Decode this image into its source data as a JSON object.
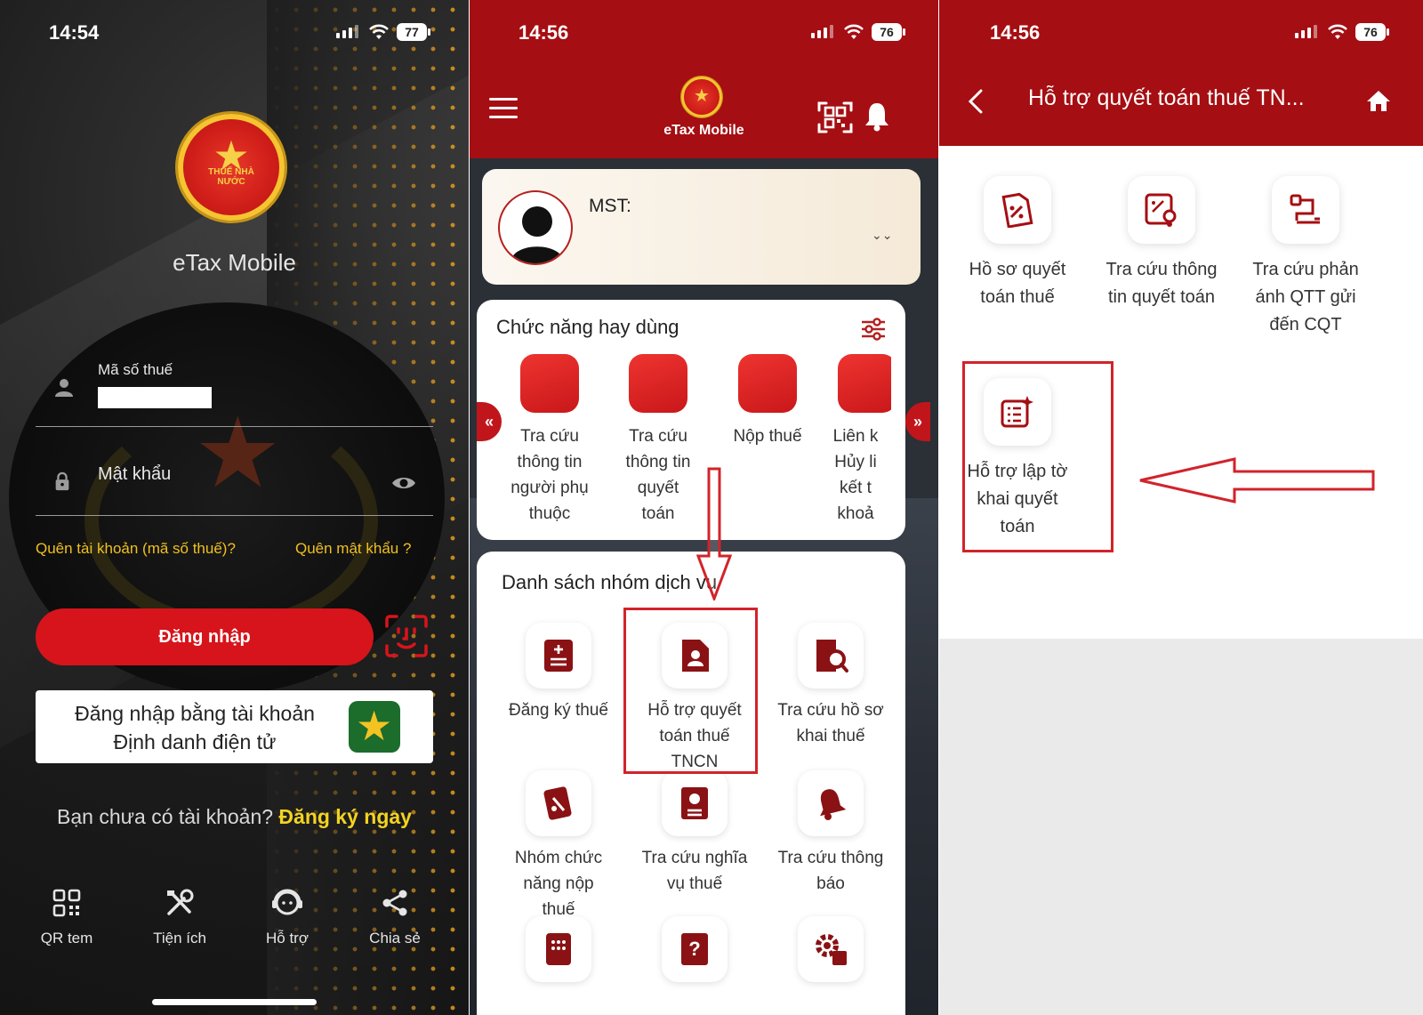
{
  "panel1": {
    "status": {
      "time": "14:54",
      "battery": "77"
    },
    "emblem_text": "THUẾ NHÀ NƯỚC",
    "app_title": "eTax Mobile",
    "tax_code_label": "Mã số thuế",
    "password_placeholder": "Mật khẩu",
    "forgot_account": "Quên tài khoản (mã số thuế)?",
    "forgot_password": "Quên mật khẩu ?",
    "login_button": "Đăng nhập",
    "vneid_login_line1": "Đăng nhập bằng tài khoản",
    "vneid_login_line2": "Định danh điện tử",
    "no_account": "Bạn chưa có tài khoản?",
    "register_now": "Đăng ký ngay",
    "bottom_nav": [
      {
        "label": "QR tem",
        "icon": "qr-icon"
      },
      {
        "label": "Tiện ích",
        "icon": "tools-icon"
      },
      {
        "label": "Hỗ trợ",
        "icon": "support-icon"
      },
      {
        "label": "Chia sẻ",
        "icon": "share-icon"
      }
    ]
  },
  "panel2": {
    "status": {
      "time": "14:56",
      "battery": "76"
    },
    "app_title": "eTax Mobile",
    "mst_label": "MST:",
    "favorites_title": "Chức năng hay dùng",
    "favorites": [
      {
        "line1": "Tra cứu",
        "line2": "thông tin",
        "line3": "người phụ",
        "line4": "thuộc"
      },
      {
        "line1": "Tra cứu",
        "line2": "thông tin",
        "line3": "quyết",
        "line4": "toán"
      },
      {
        "line1": "Nộp thuế",
        "line2": "",
        "line3": "",
        "line4": ""
      },
      {
        "line1": "Liên k",
        "line2": "Hủy li",
        "line3": "kết t",
        "line4": "khoả"
      }
    ],
    "services_title": "Danh sách nhóm dịch vụ",
    "services": [
      {
        "line1": "Đăng ký thuế",
        "line2": "",
        "line3": "",
        "icon": "tax-register-icon"
      },
      {
        "line1": "Hỗ trợ quyết",
        "line2": "toán thuế",
        "line3": "TNCN",
        "icon": "tax-settlement-icon"
      },
      {
        "line1": "Tra cứu hồ sơ",
        "line2": "khai thuế",
        "line3": "",
        "icon": "search-file-icon"
      },
      {
        "line1": "Nhóm chức",
        "line2": "năng nộp",
        "line3": "thuế",
        "icon": "payment-icon"
      },
      {
        "line1": "Tra cứu nghĩa",
        "line2": "vụ thuế",
        "line3": "",
        "icon": "obligation-icon"
      },
      {
        "line1": "Tra cứu thông",
        "line2": "báo",
        "line3": "",
        "icon": "notification-bell-icon"
      }
    ]
  },
  "panel3": {
    "status": {
      "time": "14:56",
      "battery": "76"
    },
    "title": "Hỗ trợ quyết toán thuế TN...",
    "items": [
      {
        "line1": "Hồ sơ quyết",
        "line2": "toán thuế",
        "line3": ""
      },
      {
        "line1": "Tra cứu thông",
        "line2": "tin quyết toán",
        "line3": ""
      },
      {
        "line1": "Tra cứu phản",
        "line2": "ánh QTT gửi",
        "line3": "đến CQT"
      },
      {
        "line1": "Hỗ trợ lập tờ",
        "line2": "khai quyết",
        "line3": "toán"
      }
    ]
  },
  "colors": {
    "brand_red": "#a50e12",
    "accent_yellow": "#f0c020",
    "login_red": "#d7141b"
  }
}
